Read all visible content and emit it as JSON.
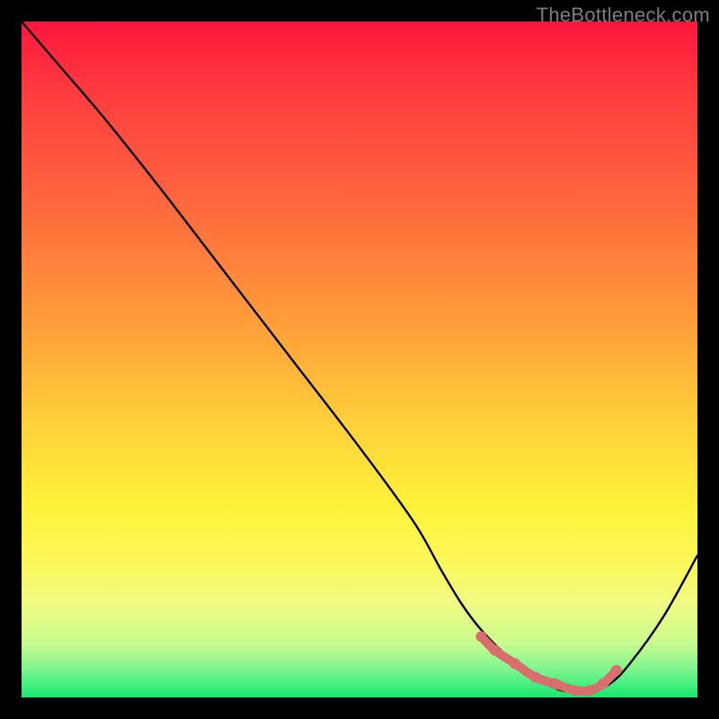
{
  "watermark": "TheBottleneck.com",
  "chart_data": {
    "type": "line",
    "title": "",
    "xlabel": "",
    "ylabel": "",
    "xlim": [
      0,
      100
    ],
    "ylim": [
      0,
      100
    ],
    "series": [
      {
        "name": "bottleneck-curve",
        "x": [
          0,
          6,
          12,
          20,
          30,
          40,
          50,
          58,
          62,
          65,
          68,
          72,
          76,
          80,
          84,
          87,
          90,
          95,
          100
        ],
        "values": [
          100,
          93,
          86,
          76,
          63,
          50,
          37,
          26,
          19,
          14,
          10,
          6,
          3,
          1,
          1,
          2,
          5,
          12,
          21
        ]
      }
    ],
    "highlight": {
      "name": "optimal-range-dots",
      "color": "#da6e6e",
      "x": [
        68,
        70,
        73,
        76,
        79,
        82,
        84,
        86,
        88
      ],
      "values": [
        9,
        7,
        5,
        3,
        2,
        1,
        1,
        2,
        4
      ]
    }
  }
}
